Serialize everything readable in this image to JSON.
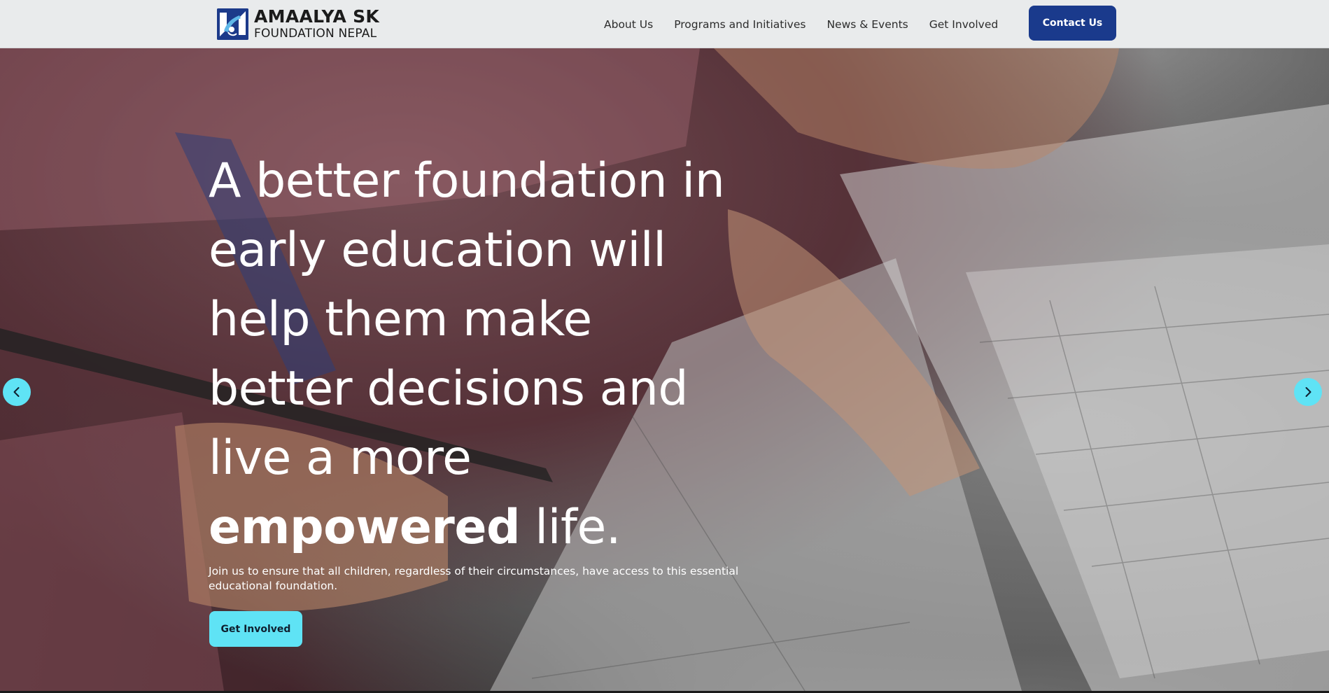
{
  "brand": {
    "name_line1": "AMAALYA SK",
    "name_line2": "FOUNDATION NEPAL",
    "logo_icon": "hands-logo-icon",
    "color": "#1a3a8c"
  },
  "nav": {
    "items": [
      {
        "label": "About Us"
      },
      {
        "label": "Programs and Initiatives"
      },
      {
        "label": "News & Events"
      },
      {
        "label": "Get Involved"
      }
    ],
    "contact_label": "Contact Us"
  },
  "hero": {
    "headline_lines": [
      "A better foundation in",
      "early education will",
      "help them make",
      "better decisions and",
      "live a more"
    ],
    "headline_bold": "empowered",
    "headline_end": " life.",
    "subtext": "Join us to ensure that all children, regardless of their circumstances, have access to this essential educational foundation.",
    "cta_label": "Get Involved",
    "cta_color": "#5fe3f5",
    "prev_icon": "chevron-left-icon",
    "next_icon": "chevron-right-icon"
  }
}
